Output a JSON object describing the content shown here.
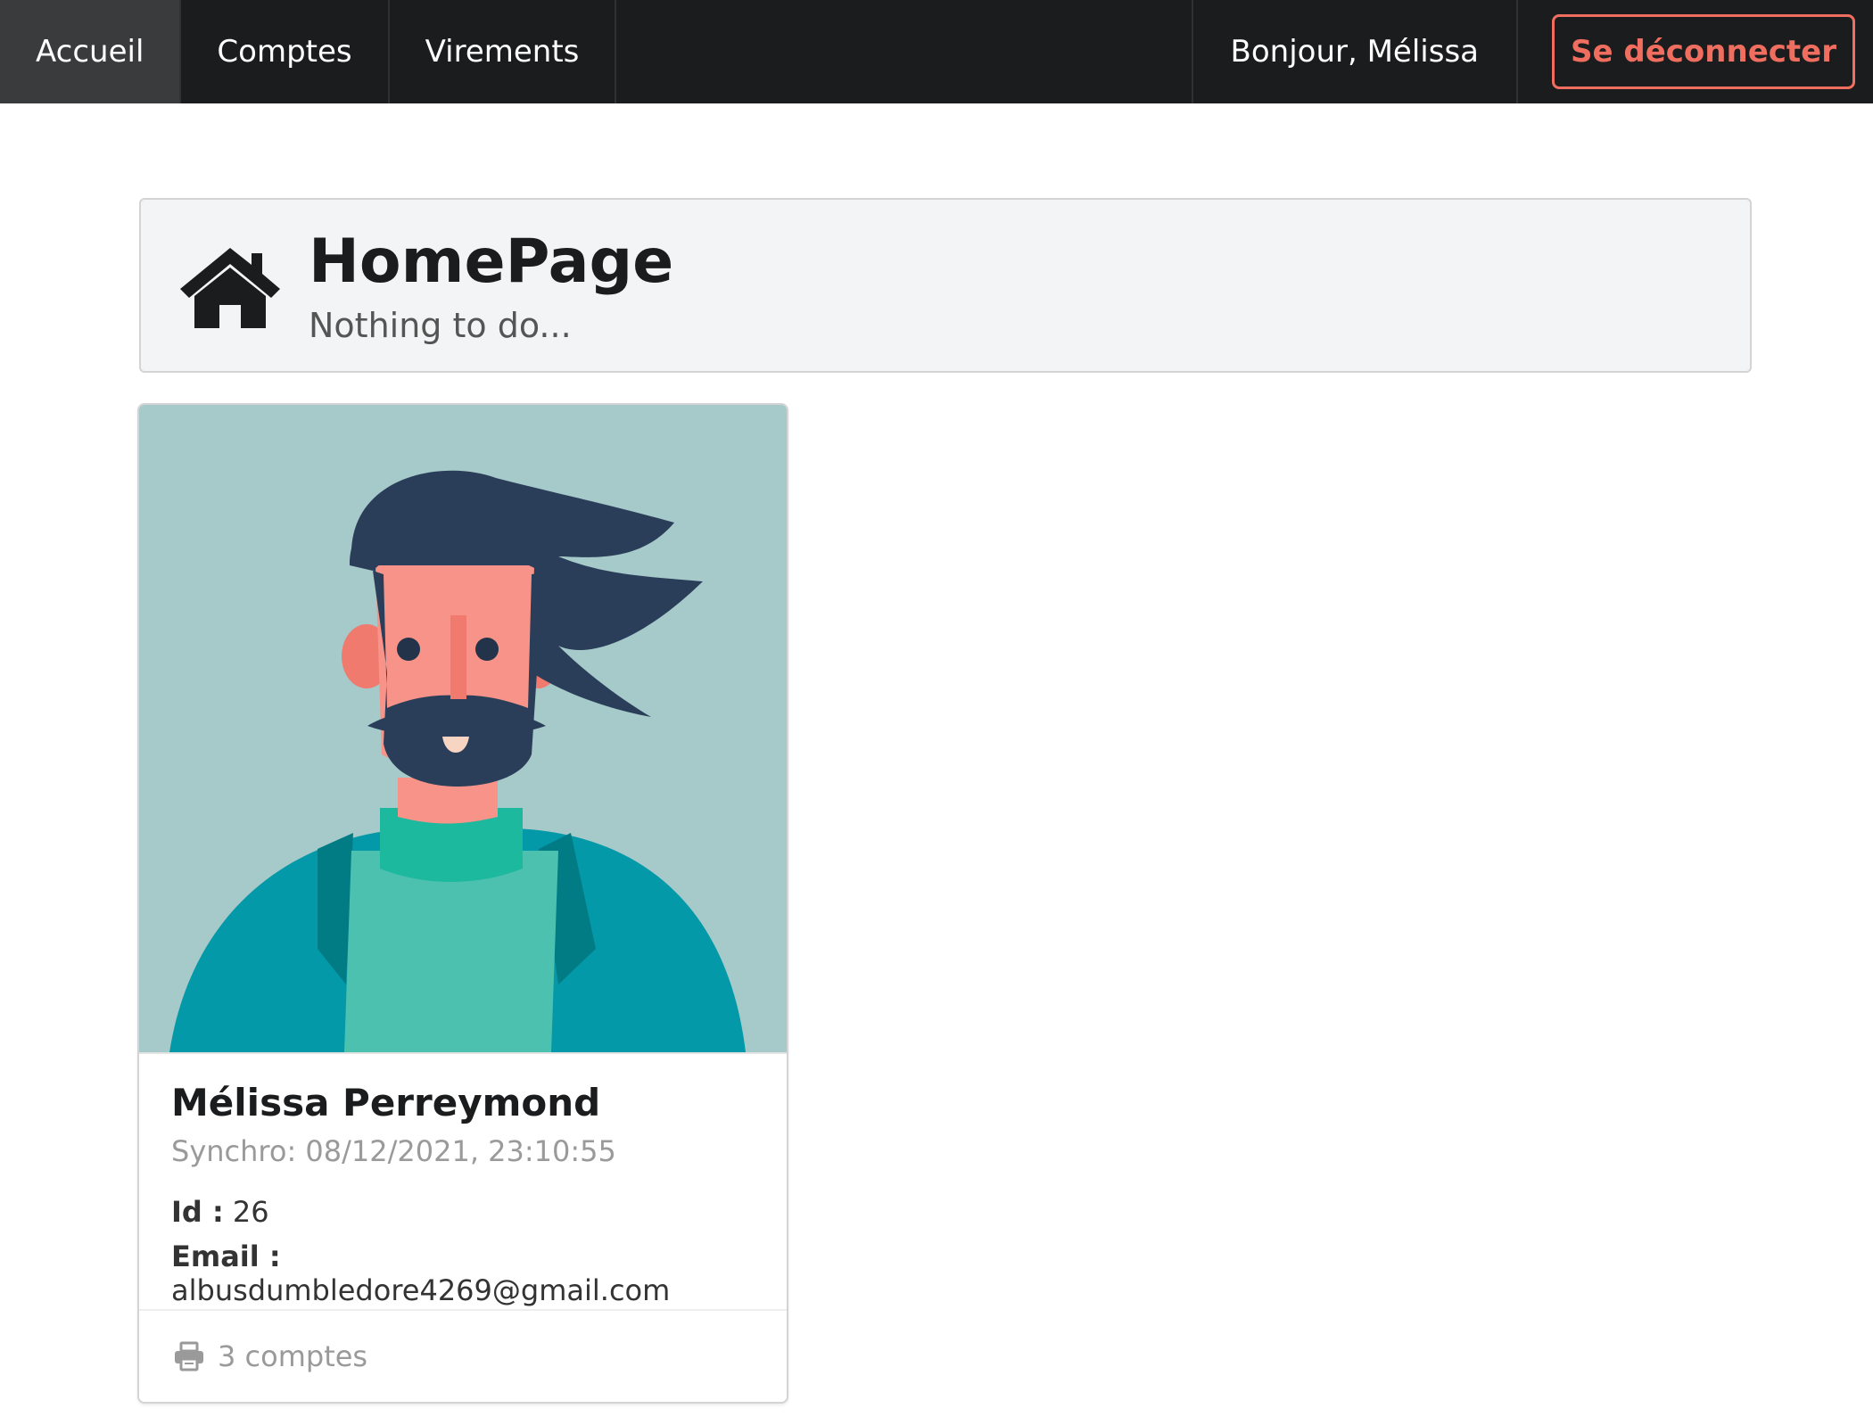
{
  "nav": {
    "items": [
      {
        "label": "Accueil",
        "active": true
      },
      {
        "label": "Comptes",
        "active": false
      },
      {
        "label": "Virements",
        "active": false
      }
    ],
    "greeting": "Bonjour, Mélissa",
    "logout_label": "Se déconnecter"
  },
  "header": {
    "icon": "home-icon",
    "title": "HomePage",
    "subtitle": "Nothing to do..."
  },
  "profile_card": {
    "name": "Mélissa Perreymond",
    "meta": "Synchro: 08/12/2021, 23:10:55",
    "id_label": "Id :",
    "id_value": "26",
    "email_label": "Email :",
    "email_value": "albusdumbledore4269@gmail.com",
    "accounts_icon": "printer-icon",
    "accounts_text": "3 comptes"
  },
  "colors": {
    "nav_bg": "#1b1c1d",
    "logout_accent": "#f06e5f",
    "avatar_bg": "#a6c9ca"
  }
}
